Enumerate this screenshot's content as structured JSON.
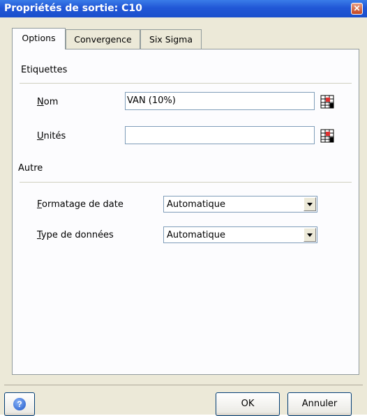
{
  "window": {
    "title": "Propriétés de sortie: C10",
    "close_glyph": "✕"
  },
  "tabs": [
    {
      "label": "Options",
      "active": true
    },
    {
      "label": "Convergence",
      "active": false
    },
    {
      "label": "Six Sigma",
      "active": false
    }
  ],
  "labels_section": {
    "title": "Etiquettes",
    "name_label_key": "N",
    "name_label_rest": "om",
    "name_value": "VAN (10%)",
    "units_label_key": "U",
    "units_label_rest": "nités",
    "units_value": ""
  },
  "other_section": {
    "title": "Autre",
    "date_format_label_key": "F",
    "date_format_label_rest": "ormatage de date",
    "date_format_value": "Automatique",
    "data_type_label_key": "T",
    "data_type_label_rest": "ype de données",
    "data_type_value": "Automatique"
  },
  "footer": {
    "ok_label": "OK",
    "cancel_label": "Annuler",
    "help_glyph": "?"
  }
}
